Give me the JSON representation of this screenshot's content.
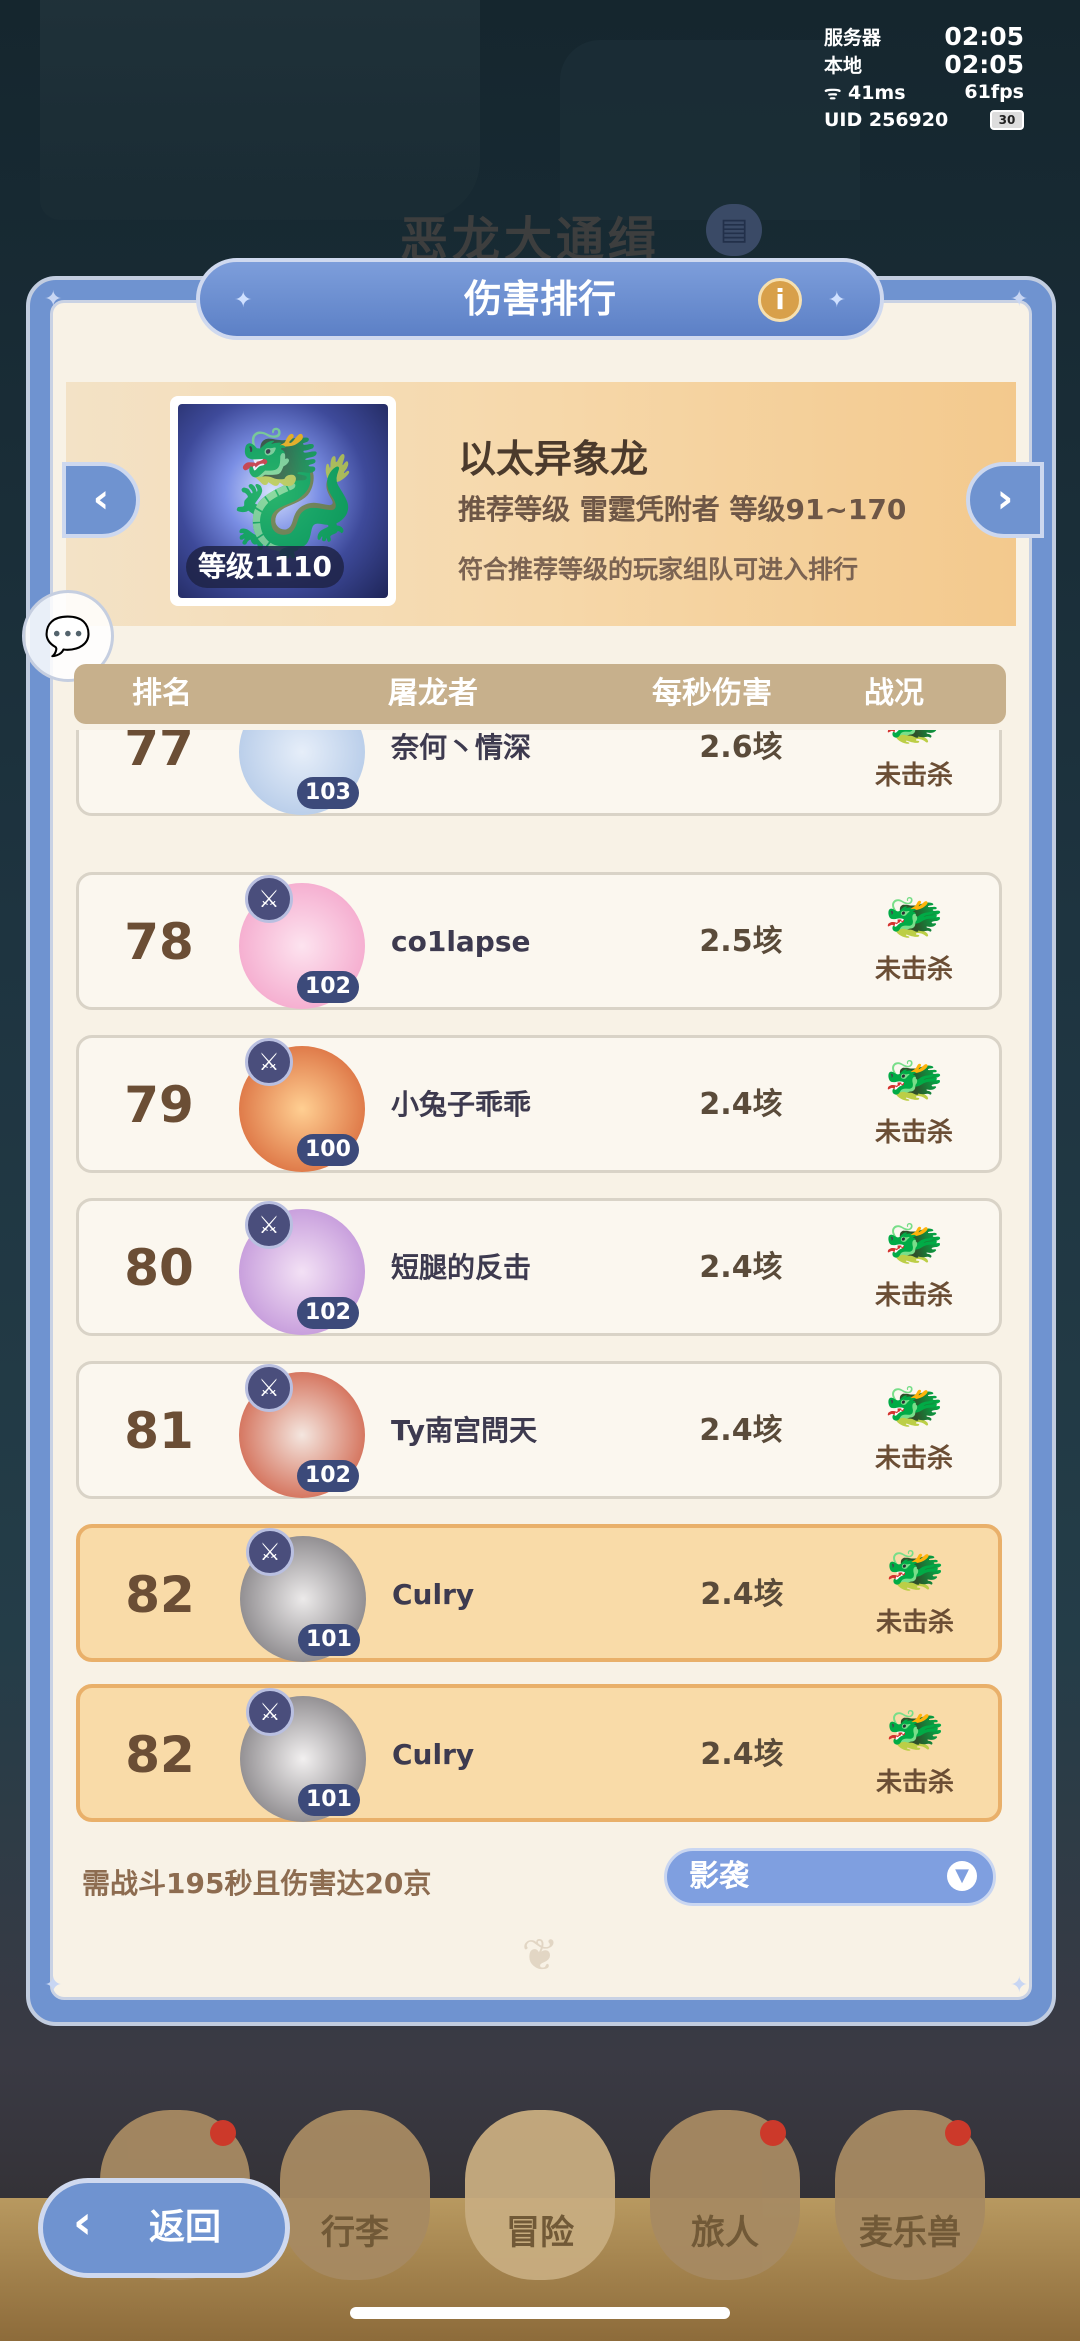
{
  "status": {
    "server_label": "服务器",
    "server_time": "02:05",
    "local_label": "本地",
    "local_time": "02:05",
    "ping": "41ms",
    "fps": "61fps",
    "uid": "UID 256920",
    "battery": "30"
  },
  "background": {
    "title": "恶龙大通缉"
  },
  "panel": {
    "title": "伤害排行",
    "info_icon": "i"
  },
  "boss": {
    "level_badge": "等级1110",
    "name": "以太异象龙",
    "recommend": "推荐等级 雷霆凭附者  等级91~170",
    "note": "符合推荐等级的玩家组队可进入排行"
  },
  "table": {
    "headers": {
      "rank": "排名",
      "slayer": "屠龙者",
      "dps": "每秒伤害",
      "status": "战况"
    },
    "rows": [
      {
        "rank": "77",
        "level": "103",
        "name": "奈何丶情深",
        "dps": "2.6垓",
        "status": "未击杀"
      },
      {
        "rank": "78",
        "level": "102",
        "name": "co1lapse",
        "dps": "2.5垓",
        "status": "未击杀"
      },
      {
        "rank": "79",
        "level": "100",
        "name": "小兔子乖乖",
        "dps": "2.4垓",
        "status": "未击杀"
      },
      {
        "rank": "80",
        "level": "102",
        "name": "短腿的反击",
        "dps": "2.4垓",
        "status": "未击杀"
      },
      {
        "rank": "81",
        "level": "102",
        "name": "Ty南宫問天",
        "dps": "2.4垓",
        "status": "未击杀"
      },
      {
        "rank": "82",
        "level": "101",
        "name": "Culry",
        "dps": "2.4垓",
        "status": "未击杀"
      },
      {
        "rank": "82",
        "level": "101",
        "name": "Culry",
        "dps": "2.4垓",
        "status": "未击杀"
      }
    ]
  },
  "footer": {
    "requirement": "需战斗195秒且伤害达20京",
    "dropdown_value": "影袭"
  },
  "bottom_nav": {
    "back_label": "返回",
    "tabs": [
      "行李",
      "冒险",
      "旅人",
      "麦乐兽"
    ]
  },
  "colors": {
    "panel_blue": "#6f93d0",
    "parchment": "#f8f2e6",
    "highlight_row": "#f9dba8",
    "header_tan": "#c7b08c"
  }
}
